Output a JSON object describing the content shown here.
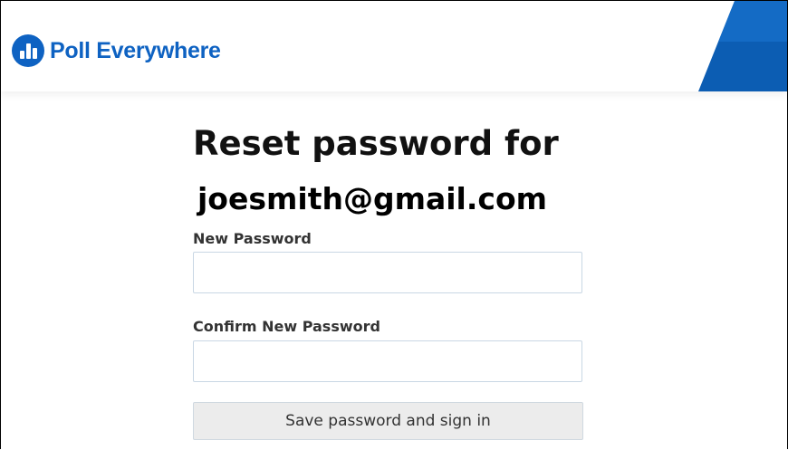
{
  "header": {
    "logo_text": "Poll Everywhere",
    "brand_color": "#0e62c2"
  },
  "page": {
    "title_line1": "Reset password for",
    "title_line2": "joesmith@gmail.com"
  },
  "form": {
    "new_password_label": "New Password",
    "new_password_value": "",
    "confirm_password_label": "Confirm New Password",
    "confirm_password_value": "",
    "submit_label": "Save password and sign in"
  },
  "icons": {
    "logo": "poll-everywhere-logo-icon"
  }
}
